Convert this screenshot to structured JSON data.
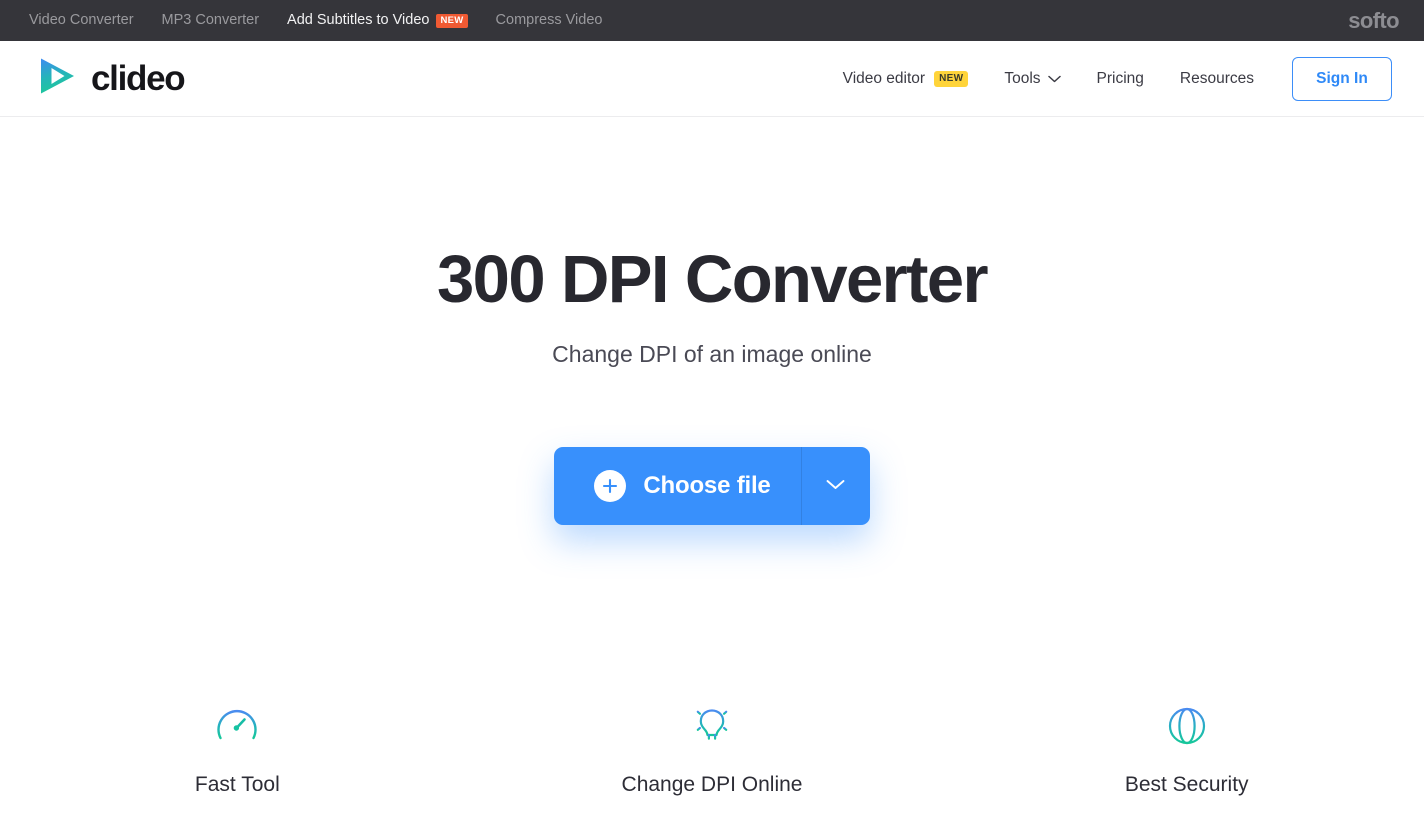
{
  "topbar": {
    "links": [
      {
        "label": "Video Converter",
        "active": false,
        "badge": null
      },
      {
        "label": "MP3 Converter",
        "active": false,
        "badge": null
      },
      {
        "label": "Add Subtitles to Video",
        "active": true,
        "badge": "NEW"
      },
      {
        "label": "Compress Video",
        "active": false,
        "badge": null
      }
    ],
    "brand": "softo",
    "background_color": "#35353a",
    "badge_color": "#f05a33"
  },
  "header": {
    "logo_text": "clideo",
    "nav": [
      {
        "label": "Video editor",
        "badge": "NEW",
        "caret": false
      },
      {
        "label": "Tools",
        "badge": null,
        "caret": true
      },
      {
        "label": "Pricing",
        "badge": null,
        "caret": false
      },
      {
        "label": "Resources",
        "badge": null,
        "caret": false
      }
    ],
    "sign_in_label": "Sign In",
    "accent_color": "#2f89f7",
    "nav_badge_color": "#ffd43a"
  },
  "hero": {
    "title": "300 DPI Converter",
    "subtitle": "Change DPI of an image online",
    "cta_label": "Choose file",
    "cta_color": "#3890fc"
  },
  "features": [
    {
      "label": "Fast Tool",
      "icon": "speedometer-icon"
    },
    {
      "label": "Change DPI Online",
      "icon": "lightbulb-icon"
    },
    {
      "label": "Best Security",
      "icon": "globe-icon"
    }
  ]
}
